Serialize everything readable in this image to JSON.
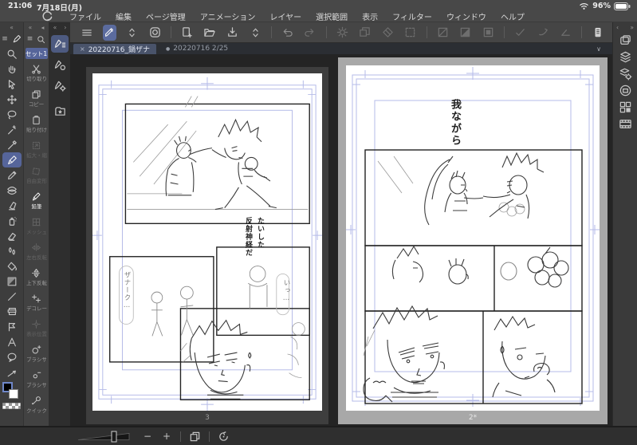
{
  "status_bar": {
    "time": "21:06",
    "date": "7月18日(月)",
    "battery_level": "96%",
    "icons": [
      "wifi-icon",
      "battery-icon"
    ]
  },
  "menu_bar": {
    "logo_icon": "clip-studio-logo",
    "items": [
      "ファイル",
      "編集",
      "ページ管理",
      "アニメーション",
      "レイヤー",
      "選択範囲",
      "表示",
      "フィルター",
      "ウィンドウ",
      "ヘルプ"
    ]
  },
  "toolbar": {
    "icons": [
      "hamburger-menu-icon",
      "current-tool-brush-icon",
      "tool-chevrons-icon",
      "gallery-icon",
      "new-page-icon",
      "open-file-icon",
      "export-icon",
      "export-chevrons-icon",
      "undo-icon",
      "redo-icon",
      "process-icon",
      "duplicate-icon",
      "eraser-diamond-icon",
      "select-area-icon",
      "deselect-icon",
      "invert-selection-icon",
      "fill-selection-icon",
      "snap-check-icon",
      "snap-curve-icon",
      "snap-angle-icon",
      "companion-device-icon",
      "help-icon"
    ]
  },
  "tool_panel": {
    "tools": [
      "zoom",
      "hand",
      "operation",
      "move-layer",
      "lasso",
      "auto-select",
      "eyedropper",
      "pen",
      "brush",
      "decoration",
      "eraser",
      "airbrush",
      "eraser-hard",
      "blend",
      "fill",
      "gradient",
      "figure",
      "frame-border",
      "flag",
      "text",
      "balloon",
      "correction-line"
    ],
    "selected_tool": "pen",
    "foreground_color": "#000000",
    "background_color": "#ffffff"
  },
  "quick_access": {
    "header": "セット1",
    "items": [
      {
        "label": "切り取り",
        "icon": "scissors-icon",
        "enabled": true
      },
      {
        "label": "コピー",
        "icon": "copy-icon",
        "enabled": true
      },
      {
        "label": "貼り付け",
        "icon": "paste-icon",
        "enabled": true
      },
      {
        "label": "拡大・縮",
        "icon": "scale-icon",
        "enabled": false
      },
      {
        "label": "自由変形",
        "icon": "free-transform-icon",
        "enabled": false
      },
      {
        "label": "鉛筆",
        "icon": "pencil-icon",
        "enabled": true,
        "active": true
      },
      {
        "label": "メッシュ",
        "icon": "mesh-icon",
        "enabled": false
      },
      {
        "label": "左右反転",
        "icon": "flip-horizontal-icon",
        "enabled": false
      },
      {
        "label": "上下反転",
        "icon": "flip-vertical-icon",
        "enabled": true
      },
      {
        "label": "デコレー",
        "icon": "decoration-icon",
        "enabled": true
      },
      {
        "label": "表示位置",
        "icon": "view-position-icon",
        "enabled": false
      },
      {
        "label": "ブラシサ",
        "icon": "brush-size-up-icon",
        "enabled": true
      },
      {
        "label": "ブラシサ",
        "icon": "brush-size-down-icon",
        "enabled": true
      },
      {
        "label": "クイック",
        "icon": "wrench-icon",
        "enabled": true
      }
    ]
  },
  "subtool_bar": {
    "icons": [
      "pen-lines-icon",
      "pen-circle-icon",
      "pen-gear-icon",
      "folder-star-icon"
    ]
  },
  "right_sidebar": {
    "icons": [
      "canvas-icon",
      "layers-icon",
      "layer-property-icon",
      "navigator-icon",
      "material-icon",
      "timeline-icon"
    ]
  },
  "tabs": {
    "active": {
      "close": "×",
      "label": "20220716_鍋ザナ"
    },
    "inactive": {
      "dot": "●",
      "label": "20220716 2/25"
    },
    "collapse_chevron": "∨"
  },
  "canvas": {
    "left_page": {
      "number": "3",
      "dialogs": {
        "line1": "たいした",
        "line2": "反射神経だ",
        "bubble1": "ザナーク…",
        "bubble2": "いっ…"
      }
    },
    "right_page": {
      "number": "2*",
      "caption": "我ながら"
    }
  },
  "bottom_bar": {
    "zoom_out": "−",
    "zoom_in": "+",
    "icons": [
      "zoom-slider",
      "fit-screen-icon",
      "rotate-reset-icon"
    ]
  },
  "colors": {
    "accent": "#5b6b9e",
    "selected_tab": "#49536a",
    "guide_blue": "#b5bbe8",
    "selected_page_frame": "#a8a8a8"
  }
}
